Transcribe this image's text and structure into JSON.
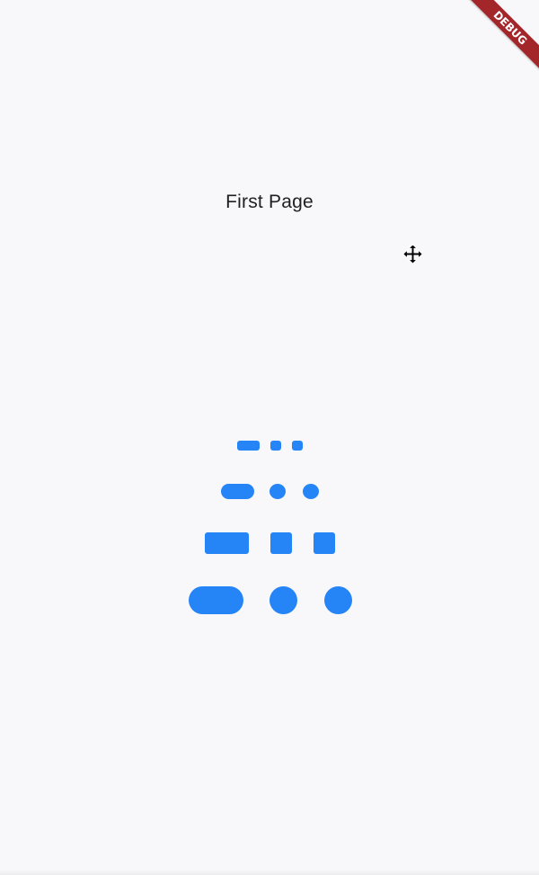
{
  "app": {
    "debug_banner_label": "DEBUG"
  },
  "page": {
    "title": "First Page"
  },
  "cursor": {
    "icon": "move-cursor-icon"
  },
  "loading_indicator": {
    "icon": "page-indicator-dots",
    "color": "#2585f7"
  },
  "colors": {
    "background": "#f8f7f9",
    "accent": "#2585f7",
    "debug_banner": "#a3262b",
    "text": "#1f1f24"
  }
}
